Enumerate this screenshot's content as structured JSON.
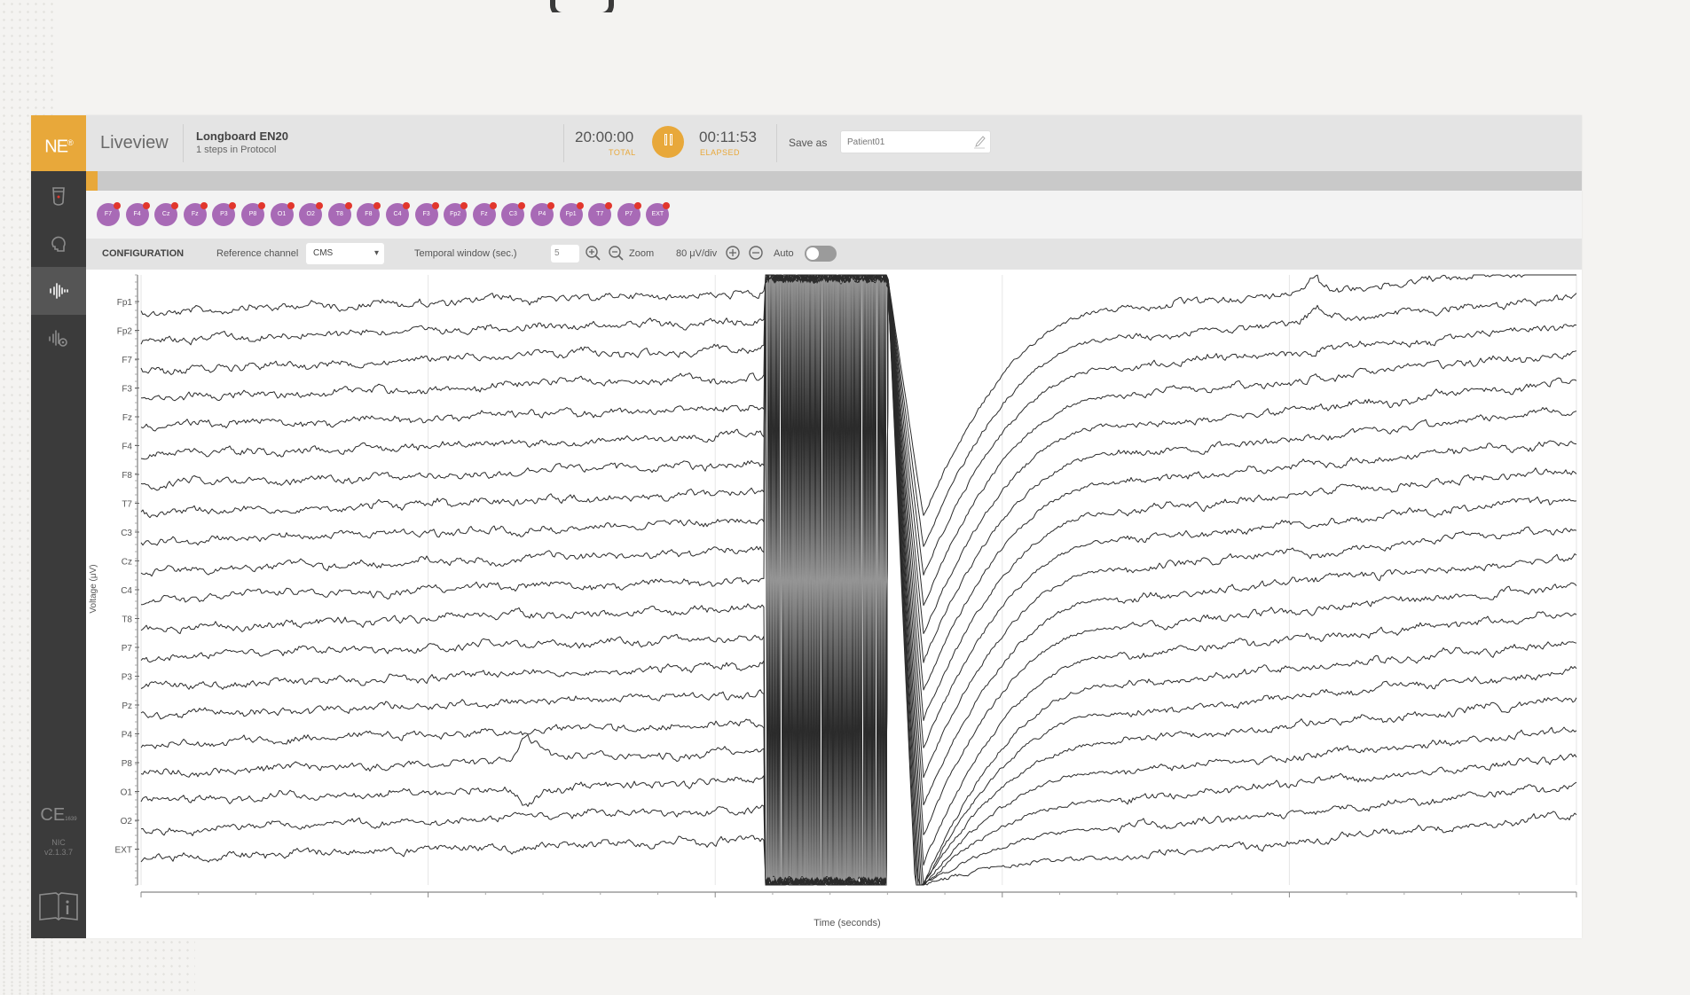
{
  "header": {
    "view_title": "Liveview",
    "protocol_name": "Longboard EN20",
    "protocol_steps": "1 steps in Protocol",
    "total_time": "20:00:00",
    "total_label": "TOTAL",
    "elapsed_time": "00:11:53",
    "elapsed_label": "ELAPSED",
    "save_as_label": "Save as",
    "save_as_placeholder": "Patient01"
  },
  "sidebar": {
    "logo": "NE",
    "logo_mark": "®",
    "ce_mark": "CE",
    "ce_number": "1639",
    "software_name": "NIC",
    "software_version": "v2.1.3.7"
  },
  "progress": {
    "fraction": 0.008
  },
  "electrodes": [
    "F7",
    "F4",
    "Cz",
    "Fz",
    "P3",
    "P8",
    "O1",
    "O2",
    "T8",
    "F8",
    "C4",
    "F3",
    "Fp2",
    "Fz",
    "C3",
    "P4",
    "Fp1",
    "T7",
    "P7",
    "EXT"
  ],
  "config": {
    "title": "CONFIGURATION",
    "reference_label": "Reference channel",
    "reference_value": "CMS",
    "temporal_label": "Temporal window (sec.)",
    "temporal_value": "5",
    "zoom_label": "Zoom",
    "scale_label": "80 μV/div",
    "auto_label": "Auto",
    "auto_on": false
  },
  "chart_data": {
    "type": "line",
    "title": "",
    "xlabel": "Time (seconds)",
    "ylabel": "Voltage (μV)",
    "channels": [
      "Fp1",
      "Fp2",
      "F7",
      "F3",
      "Fz",
      "F4",
      "F8",
      "T7",
      "C3",
      "Cz",
      "C4",
      "T8",
      "P7",
      "P3",
      "Pz",
      "P4",
      "P8",
      "O1",
      "O2",
      "EXT"
    ],
    "trend_per_window": 0.6,
    "artifact": {
      "start_fraction": 0.435,
      "blackout_end": 0.52,
      "recovery_min": 0.545,
      "recovery_end": 0.68,
      "depth_rows": 7.5
    },
    "events": [
      {
        "channel": "Fp1",
        "type": "bump",
        "at_fraction": 0.82,
        "size": -18
      },
      {
        "channel": "Fp2",
        "type": "bump",
        "at_fraction": 0.82,
        "size": -14
      },
      {
        "channel": "P8",
        "type": "bump",
        "at_fraction": 0.27,
        "size": -25
      },
      {
        "channel": "O1",
        "type": "bump",
        "at_fraction": 0.27,
        "size": 20
      }
    ]
  },
  "colors": {
    "accent": "#e8a83a",
    "sidebar": "#3b3b3b",
    "electrode": "#a86ab6",
    "electrode_status": "#e2362c",
    "trace": "#2b2b2b"
  }
}
